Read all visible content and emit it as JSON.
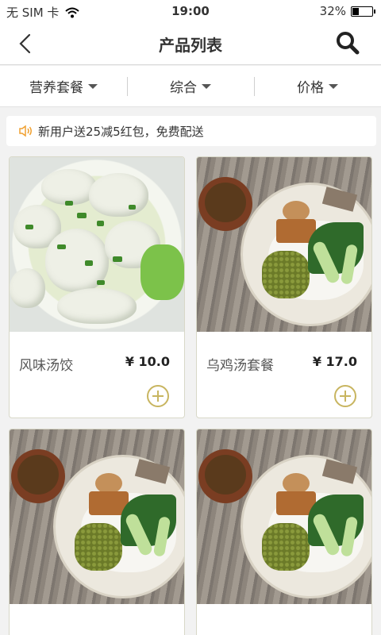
{
  "status_bar": {
    "carrier": "无 SIM 卡",
    "time": "19:00",
    "battery_percent": "32%",
    "battery_level": 0.32
  },
  "nav": {
    "title": "产品列表",
    "back_icon": "chevron-left-icon",
    "search_icon": "search-icon"
  },
  "filters": [
    {
      "label": "营养套餐"
    },
    {
      "label": "综合"
    },
    {
      "label": "价格"
    }
  ],
  "notice": {
    "icon": "speaker-icon",
    "text": "新用户送25减5红包，免费配送",
    "icon_color": "#f0a030"
  },
  "products": [
    {
      "name": "风味汤饺",
      "price": "¥ 10.0"
    },
    {
      "name": "乌鸡汤套餐",
      "price": "¥ 17.0"
    },
    {
      "name": "",
      "price": ""
    },
    {
      "name": "",
      "price": ""
    }
  ],
  "colors": {
    "accent": "#c8b560",
    "background": "#f2f2f2"
  }
}
